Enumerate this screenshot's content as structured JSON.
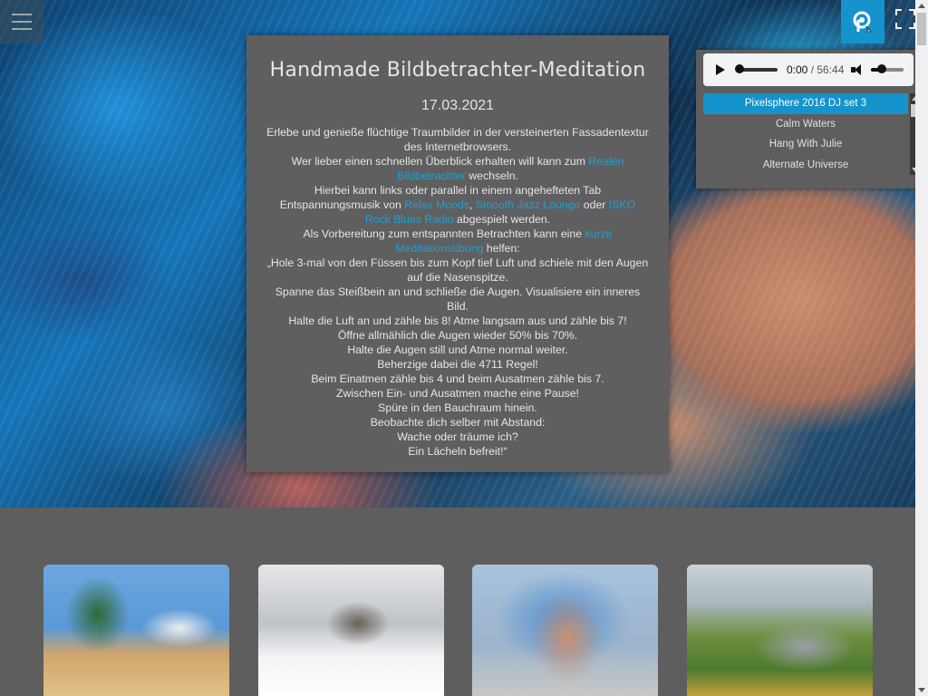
{
  "article": {
    "title": "Handmade Bildbetrachter-Meditation",
    "date": "17.03.2021",
    "p1": "Erlebe und genieße flüchtige Traumbilder in der versteinerten Fassadentextur des Internetbrowsers.",
    "p2_pre": "Wer lieber einen schnellen Überblick erhalten will kann zum ",
    "link_realen": "Realen Bildbetrachter",
    "p2_post": " wechseln.",
    "p3_pre": "Hierbei kann links oder parallel in einem angehefteten Tab Entspannungsmusik von ",
    "link_relax": "Relax Moods",
    "p3_sep1": ", ",
    "link_smooth": "Smooth Jazz Lounge",
    "p3_sep2": " oder ",
    "link_isko": "ISKO Rock Blues Radio",
    "p3_post": " abgespielt werden.",
    "p4_pre": "Als Vorbereitung zum entspannten Betrachten kann eine ",
    "link_kurze": "kurze Meditationsübung",
    "p4_post": " helfen:",
    "lines": [
      "„Hole 3-mal von den Füssen bis zum Kopf tief Luft und schiele mit den Augen auf die Nasenspitze.",
      "Spanne das Steißbein an und schließe die Augen. Visualisiere ein inneres Bild.",
      "Halte die Luft an und zähle bis 8! Atme langsam aus und zähle bis 7!",
      "Öffne allmählich die Augen wieder 50% bis 70%.",
      "Halte die Augen still und Atme normal weiter.",
      "Beherzige dabei die 4711 Regel!",
      "Beim Einatmen zähle bis 4 und beim Ausatmen zähle bis 7.",
      "Zwischen Ein- und Ausatmen mache eine Pause!",
      "Spüre in den Bauchraum hinein.",
      "Beobachte dich selber mit Abstand:",
      "Wache oder träume ich?",
      "Ein Lächeln befreit!“"
    ]
  },
  "player": {
    "current_time": "0:00",
    "separator": " / ",
    "duration": "56:44",
    "progress": 0,
    "volume": 0.4,
    "playlist": [
      "Pixelsphere 2016 DJ set 3",
      "Calm Waters",
      "Hang With Julie",
      "Alternate Universe"
    ],
    "active_index": 0
  },
  "colors": {
    "accent": "#1593cc",
    "link": "#1da0d8",
    "panel": "#5f5f5f",
    "background": "#5e5e5e"
  },
  "icons": {
    "menu": "hamburger-icon",
    "radio": "radio-logo-icon",
    "fullscreen": "fullscreen-icon"
  }
}
